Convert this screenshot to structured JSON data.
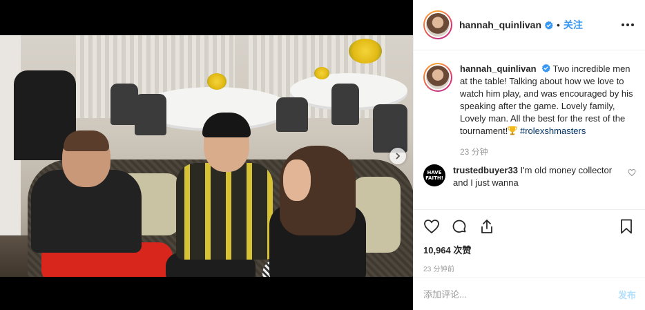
{
  "post": {
    "username": "hannah_quinlivan",
    "verified": true,
    "follow_label": "关注",
    "separator": "•",
    "more_icon": "more-horizontal-icon"
  },
  "caption": {
    "username": "hannah_quinlivan",
    "text": "Two incredible men at the table! Talking about how we love to watch him play, and was encouraged by his speaking after the game. Lovely family, Lovely man. All the best for the rest of the tournament!",
    "emoji": "trophy-icon",
    "hashtag": "#rolexshmasters",
    "time_ago": "23 分钟"
  },
  "comments": [
    {
      "username": "trustedbuyer33",
      "text": "I'm old money collector and I just wanna",
      "avatar_text": "HAVE FAITH!"
    }
  ],
  "actions": {
    "like_icon": "heart-outline-icon",
    "comment_icon": "comment-bubble-icon",
    "share_icon": "share-upload-icon",
    "save_icon": "bookmark-icon",
    "likes_text": "10,964 次赞",
    "posted_time": "23 分钟前"
  },
  "add_comment": {
    "placeholder": "添加评论...",
    "post_label": "发布"
  },
  "colors": {
    "link_blue": "#3897f0",
    "post_disabled": "#b2dffc",
    "hashtag": "#003569",
    "muted": "#999999"
  }
}
